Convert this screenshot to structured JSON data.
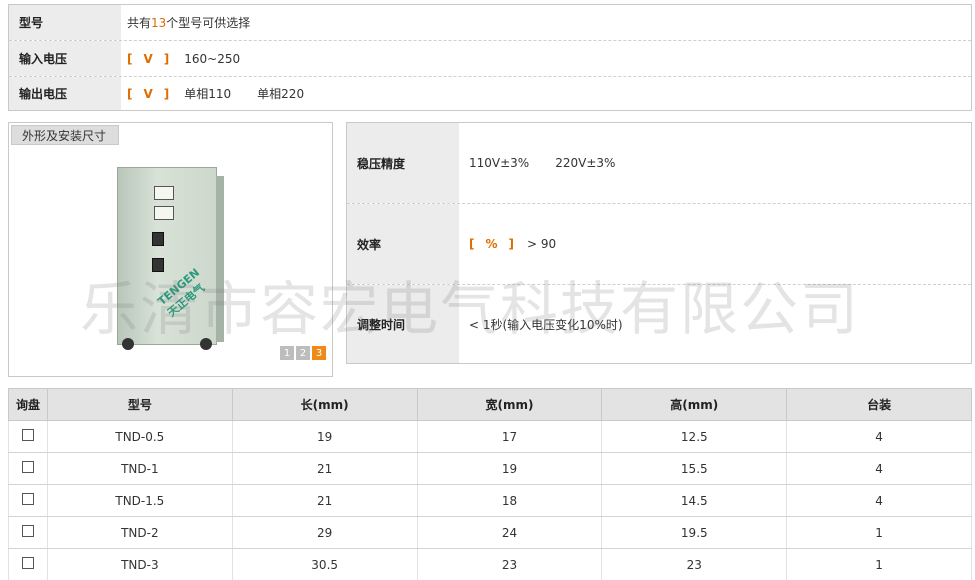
{
  "spec": {
    "model_label": "型号",
    "model_prefix": "共有",
    "model_count": "13",
    "model_suffix": "个型号可供选择",
    "input_label": "输入电压",
    "input_unit_open": "[",
    "input_unit": "V",
    "input_unit_close": "]",
    "input_value": "160~250",
    "output_label": "输出电压",
    "output_unit_open": "[",
    "output_unit": "V",
    "output_unit_close": "]",
    "output_value_1": "单相110",
    "output_value_2": "单相220"
  },
  "image_panel": {
    "tab_label": "外形及安装尺寸",
    "brand_text": "TENGEN 天正电气",
    "pages": [
      "1",
      "2",
      "3"
    ],
    "active_page": "3"
  },
  "right_spec": {
    "accuracy_label": "稳压精度",
    "accuracy_value_1": "110V±3%",
    "accuracy_value_2": "220V±3%",
    "efficiency_label": "效率",
    "efficiency_unit_open": "[",
    "efficiency_unit": "%",
    "efficiency_unit_close": "]",
    "efficiency_value": "> 90",
    "adjust_label": "调整时间",
    "adjust_value": "< 1秒(输入电压变化10%时)"
  },
  "watermark": "乐清市容宏电气科技有限公司",
  "table": {
    "headers": [
      "询盘",
      "型号",
      "长(mm)",
      "宽(mm)",
      "高(mm)",
      "台装"
    ],
    "rows": [
      {
        "model": "TND-0.5",
        "length": "19",
        "width": "17",
        "height": "12.5",
        "qty": "4"
      },
      {
        "model": "TND-1",
        "length": "21",
        "width": "19",
        "height": "15.5",
        "qty": "4"
      },
      {
        "model": "TND-1.5",
        "length": "21",
        "width": "18",
        "height": "14.5",
        "qty": "4"
      },
      {
        "model": "TND-2",
        "length": "29",
        "width": "24",
        "height": "19.5",
        "qty": "1"
      },
      {
        "model": "TND-3",
        "length": "30.5",
        "width": "23",
        "height": "23",
        "qty": "1"
      }
    ]
  },
  "colors": {
    "accent": "#e06c00",
    "label_bg": "#ececec",
    "border": "#c9c9c9"
  }
}
